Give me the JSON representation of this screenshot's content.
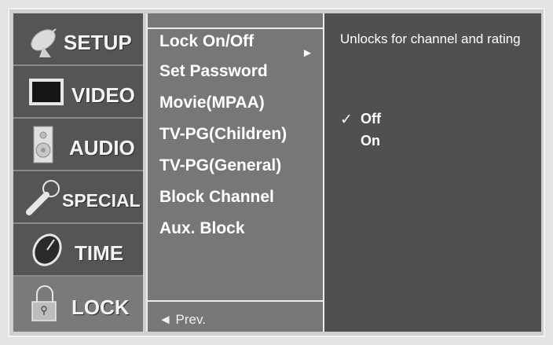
{
  "categories": [
    {
      "label": "SETUP",
      "icon": "satellite-dish-icon"
    },
    {
      "label": "VIDEO",
      "icon": "monitor-icon"
    },
    {
      "label": "AUDIO",
      "icon": "speaker-icon"
    },
    {
      "label": "SPECIAL",
      "icon": "magnifier-icon"
    },
    {
      "label": "TIME",
      "icon": "clock-icon"
    },
    {
      "label": "LOCK",
      "icon": "padlock-icon"
    }
  ],
  "selected_category": "LOCK",
  "menu": {
    "items": [
      "Lock On/Off",
      "Set Password",
      "Movie(MPAA)",
      "TV-PG(Children)",
      "TV-PG(General)",
      "Block Channel",
      "Aux. Block"
    ],
    "selected_arrow": "►",
    "prev_label": "◄ Prev."
  },
  "panel": {
    "description": "Unlocks for channel and rating",
    "check_mark": "✓",
    "options": [
      "Off",
      "On"
    ],
    "selected_option": "Off"
  },
  "colors": {
    "category_bg": "#555555",
    "menu_bg": "#777777",
    "panel_bg": "#505050",
    "frame": "#cfcfcf"
  }
}
